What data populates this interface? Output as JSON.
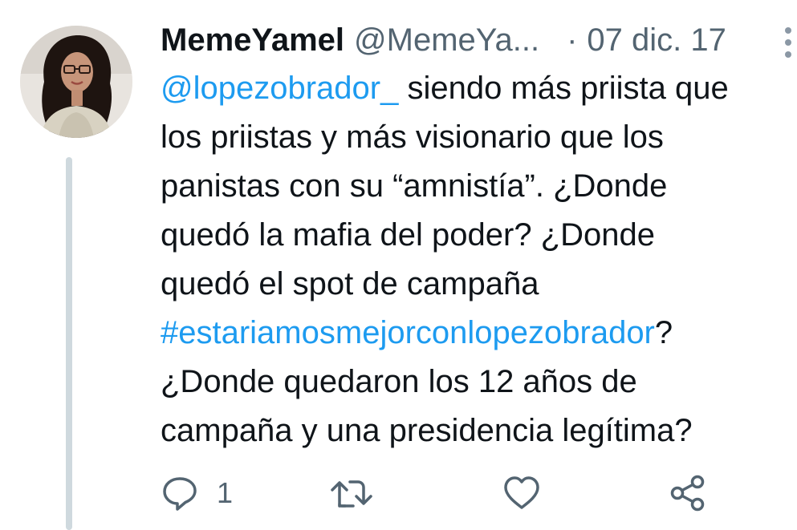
{
  "tweet": {
    "display_name": "MemeYamel",
    "handle": "@MemeYa...",
    "separator": "·",
    "date": "07 dic. 17",
    "body": {
      "line1_mention": "@lopezobrador_",
      "line1_rest": " siendo más priista que",
      "line2": "los priistas y más visionario que los",
      "line3": "panistas con su “amnistía”. ¿Donde",
      "line4": "quedó la mafia del poder? ¿Donde",
      "line5": "quedó el spot de campaña",
      "line6_hashtag": "#estariamosmejorconlopezobrador",
      "line6_rest": "?",
      "line7": "¿Donde quedaron los 12 años de",
      "line8": "campaña y una presidencia legítima?"
    }
  },
  "actions": {
    "reply_count": "1",
    "icons": [
      "reply-icon",
      "retweet-icon",
      "like-icon",
      "share-icon",
      "more-vertical-icon"
    ]
  },
  "colors": {
    "link": "#1d9bf0",
    "text": "#0f1419",
    "secondary": "#536471",
    "thread_line": "#cfd9de"
  }
}
